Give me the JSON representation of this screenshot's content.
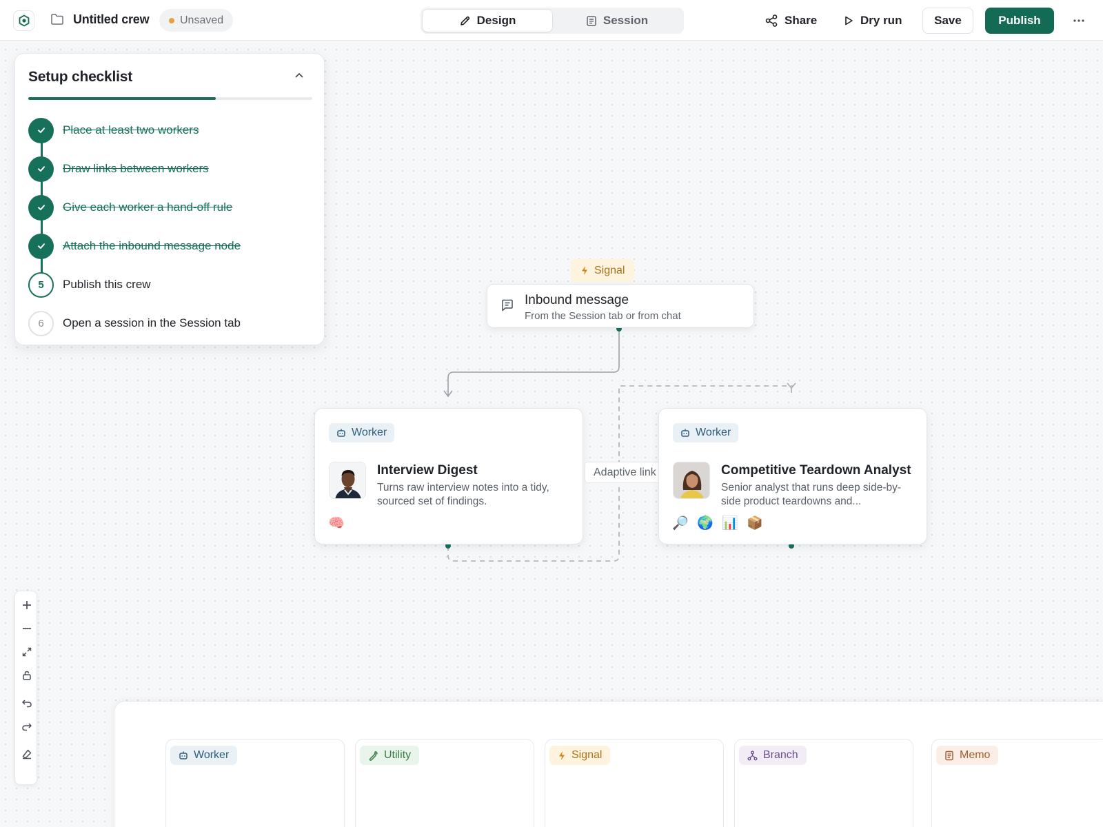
{
  "header": {
    "title": "Untitled crew",
    "status": "Unsaved",
    "tabs": [
      {
        "label": "Design",
        "active": true
      },
      {
        "label": "Session",
        "active": false
      }
    ],
    "actions": {
      "share": "Share",
      "dry_run": "Dry run",
      "save": "Save",
      "publish": "Publish"
    },
    "accent_color": "#136b56"
  },
  "checklist": {
    "title": "Setup checklist",
    "progress": 0.66,
    "items": [
      {
        "number": "1",
        "label": "Place at least two workers",
        "done": true
      },
      {
        "number": "2",
        "label": "Draw links between workers",
        "done": true
      },
      {
        "number": "3",
        "label": "Give each worker a hand-off rule",
        "done": true
      },
      {
        "number": "4",
        "label": "Attach the inbound message node",
        "done": true
      },
      {
        "number": "5",
        "label": "Publish this crew",
        "done": false,
        "current": true
      },
      {
        "number": "6",
        "label": "Open a session in the Session tab",
        "done": false
      }
    ]
  },
  "canvas": {
    "signal_node": {
      "tag": "Signal",
      "title": "Inbound message",
      "subtitle": "From the Session tab or from chat"
    },
    "workers": [
      {
        "tag": "Worker",
        "name": "Interview Digest",
        "description": "Turns raw interview notes into a tidy, sourced set of findings.",
        "tools": [
          "🧠"
        ]
      },
      {
        "tag": "Worker",
        "name": "Competitive Teardown Analyst",
        "description": "Senior analyst that runs deep side-by-side product teardowns and...",
        "tools": [
          "🔎",
          "🌍",
          "📊",
          "📦"
        ]
      }
    ],
    "edge_label": "Adaptive link"
  },
  "palette": {
    "items": [
      {
        "label": "Worker",
        "icon": "robot-icon"
      },
      {
        "label": "Utility",
        "icon": "wrench-icon"
      },
      {
        "label": "Signal",
        "icon": "bolt-icon"
      },
      {
        "label": "Branch",
        "icon": "branch-icon"
      },
      {
        "label": "Memo",
        "icon": "memo-icon"
      }
    ]
  }
}
